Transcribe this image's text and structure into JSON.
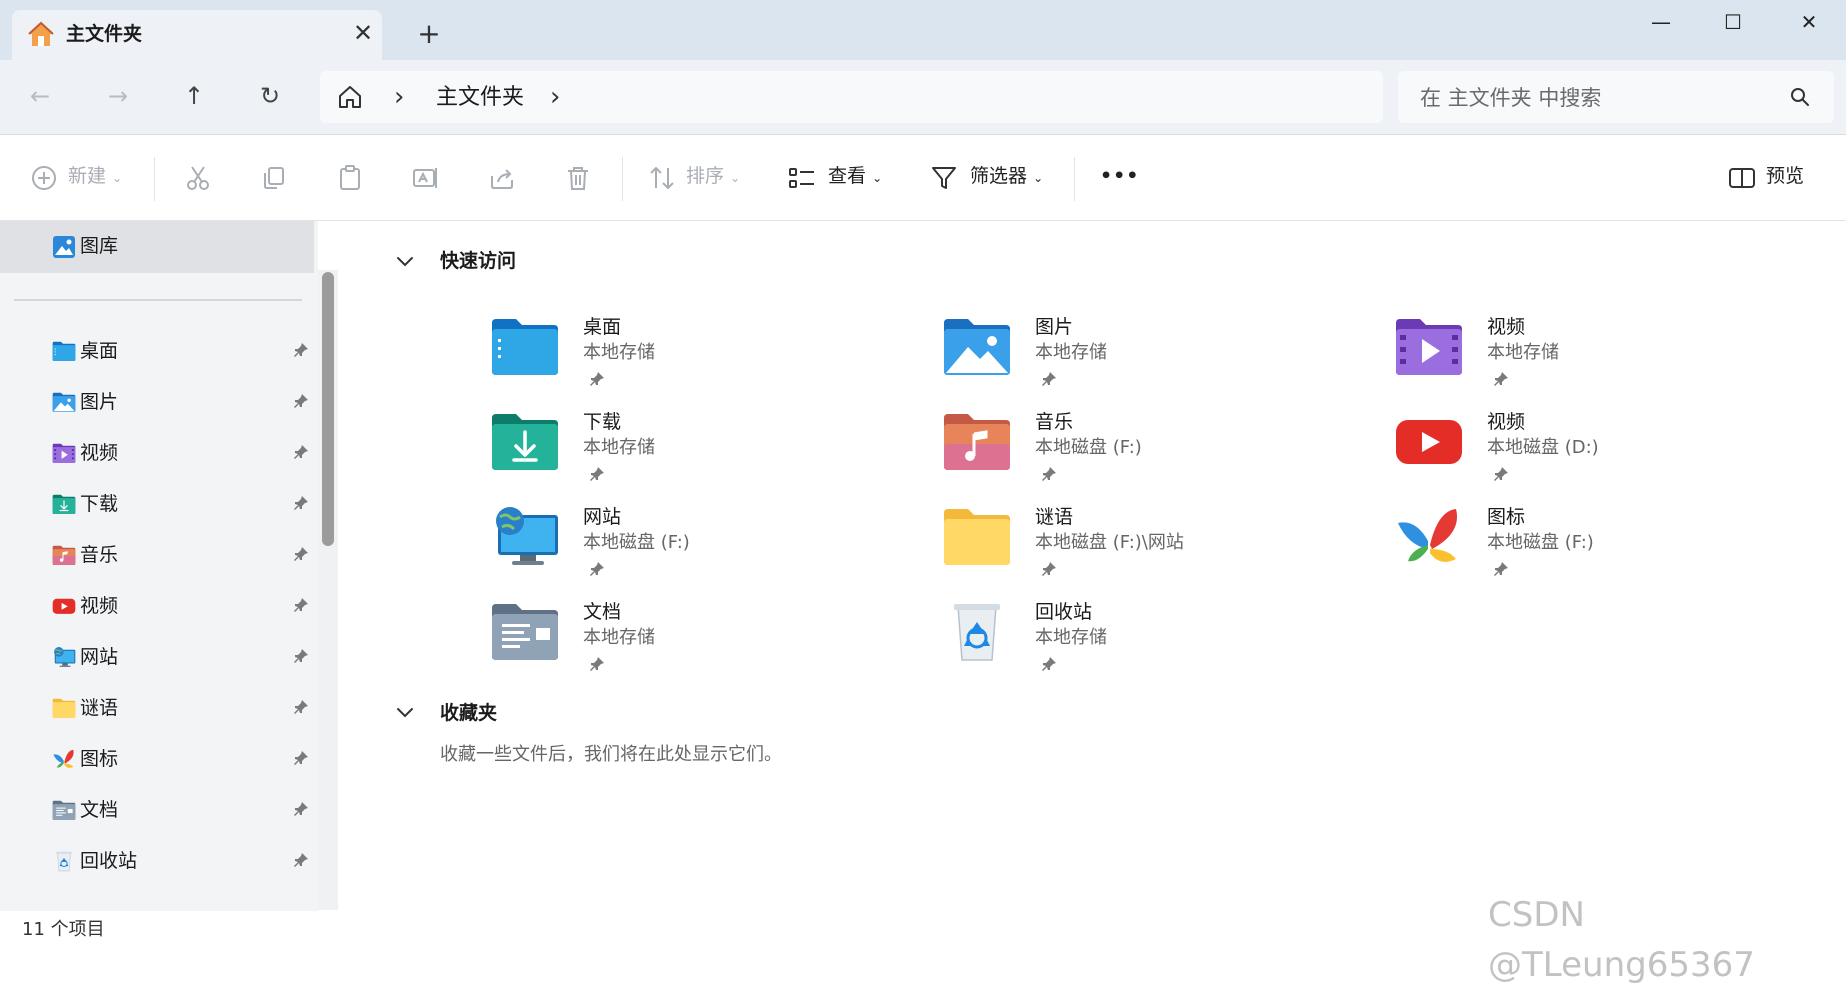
{
  "window": {
    "tab_title": "主文件夹",
    "tab_close": "✕",
    "new_tab": "+",
    "minimize": "—",
    "maximize": "☐",
    "close": "✕"
  },
  "nav": {
    "back": "←",
    "forward": "→",
    "up": "↑",
    "refresh": "↻",
    "breadcrumb": [
      "主文件夹"
    ],
    "search_placeholder": "在 主文件夹 中搜索"
  },
  "toolbar": {
    "new": "新建",
    "sort": "排序",
    "view": "查看",
    "filter": "筛选器",
    "more": "•••",
    "preview": "预览"
  },
  "sidebar": {
    "gallery": "图库",
    "items": [
      {
        "label": "桌面",
        "icon": "desktop-folder-icon"
      },
      {
        "label": "图片",
        "icon": "pictures-folder-icon"
      },
      {
        "label": "视频",
        "icon": "videos-folder-icon"
      },
      {
        "label": "下载",
        "icon": "downloads-folder-icon"
      },
      {
        "label": "音乐",
        "icon": "music-folder-icon"
      },
      {
        "label": "视频",
        "icon": "youtube-icon"
      },
      {
        "label": "网站",
        "icon": "globe-monitor-icon"
      },
      {
        "label": "谜语",
        "icon": "folder-icon"
      },
      {
        "label": "图标",
        "icon": "butterfly-icon"
      },
      {
        "label": "文档",
        "icon": "documents-folder-icon"
      },
      {
        "label": "回收站",
        "icon": "recycle-bin-icon"
      }
    ]
  },
  "main": {
    "quick_access_title": "快速访问",
    "quick_access": [
      {
        "name": "桌面",
        "location": "本地存储",
        "icon": "desktop-folder-icon"
      },
      {
        "name": "图片",
        "location": "本地存储",
        "icon": "pictures-folder-icon"
      },
      {
        "name": "视频",
        "location": "本地存储",
        "icon": "videos-folder-icon"
      },
      {
        "name": "下载",
        "location": "本地存储",
        "icon": "downloads-folder-icon"
      },
      {
        "name": "音乐",
        "location": "本地磁盘 (F:)",
        "icon": "music-folder-icon"
      },
      {
        "name": "视频",
        "location": "本地磁盘 (D:)",
        "icon": "youtube-icon"
      },
      {
        "name": "网站",
        "location": "本地磁盘 (F:)",
        "icon": "globe-monitor-icon"
      },
      {
        "name": "谜语",
        "location": "本地磁盘 (F:)\\网站",
        "icon": "folder-icon"
      },
      {
        "name": "图标",
        "location": "本地磁盘 (F:)",
        "icon": "butterfly-icon"
      },
      {
        "name": "文档",
        "location": "本地存储",
        "icon": "documents-folder-icon"
      },
      {
        "name": "回收站",
        "location": "本地存储",
        "icon": "recycle-bin-icon"
      }
    ],
    "favorites_title": "收藏夹",
    "favorites_empty": "收藏一些文件后，我们将在此处显示它们。"
  },
  "status": {
    "item_count": "11 个项目"
  },
  "watermark": "CSDN @TLeung65367",
  "colors": {
    "accent": "#0067c0",
    "titlebar": "#dbe5ef",
    "navbar": "#eef2f7",
    "sidebar": "#f3f4f6"
  }
}
